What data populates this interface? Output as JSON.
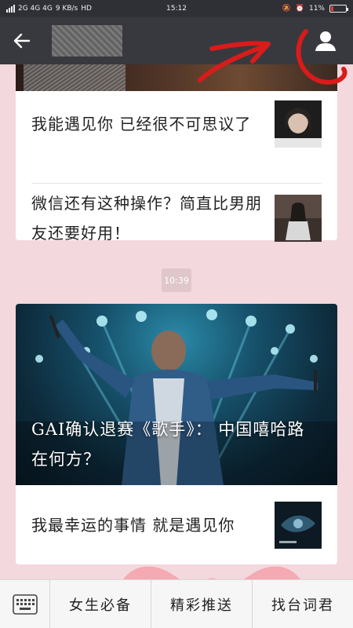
{
  "status_bar": {
    "network": "2G 4G 4G",
    "speed": "9 KB/s",
    "hd": "HD",
    "time": "15:12",
    "battery": "11%"
  },
  "header": {
    "back_icon": "arrow-left-icon",
    "profile_icon": "person-icon",
    "annotation_color": "#d81b1b"
  },
  "feed": {
    "group1": {
      "top_image_text": "",
      "items": [
        {
          "title": "我能遇见你 已经很不可思议了",
          "thumb": "photo-woman"
        },
        {
          "title": "微信还有这种操作？简直比男朋友还要好用！",
          "thumb": "photo-girl-sitting"
        }
      ]
    },
    "time_badge": "10:39",
    "group2": {
      "feature_caption": "GAI确认退赛《歌手》： 中国嘻哈路在何方？",
      "items": [
        {
          "title": "我最幸运的事情 就是遇见你",
          "thumb": "photo-dark-blue"
        }
      ]
    }
  },
  "bottom_nav": {
    "keyboard_icon": "keyboard-icon",
    "tabs": [
      "女生必备",
      "精彩推送",
      "找台词君"
    ]
  },
  "colors": {
    "background": "#f3d8dd",
    "header": "#38393e"
  }
}
